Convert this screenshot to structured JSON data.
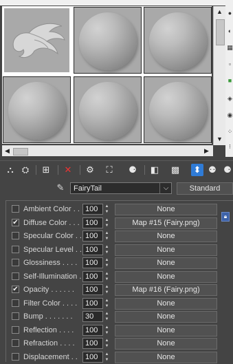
{
  "material": {
    "name": "FairyTail",
    "type": "Standard"
  },
  "maps": [
    {
      "label": "Ambient Color . .",
      "checked": false,
      "amount": "100",
      "map": "None"
    },
    {
      "label": "Diffuse Color . . .",
      "checked": true,
      "amount": "100",
      "map": "Map #15 (Fairy.png)"
    },
    {
      "label": "Specular Color . .",
      "checked": false,
      "amount": "100",
      "map": "None"
    },
    {
      "label": "Specular Level . .",
      "checked": false,
      "amount": "100",
      "map": "None"
    },
    {
      "label": "Glossiness . . . .",
      "checked": false,
      "amount": "100",
      "map": "None"
    },
    {
      "label": "Self-Illumination .",
      "checked": false,
      "amount": "100",
      "map": "None"
    },
    {
      "label": "Opacity . . . . . .",
      "checked": true,
      "amount": "100",
      "map": "Map #16 (Fairy.png)"
    },
    {
      "label": "Filter Color . . . .",
      "checked": false,
      "amount": "100",
      "map": "None"
    },
    {
      "label": "Bump . . . . . . .",
      "checked": false,
      "amount": "30",
      "map": "None"
    },
    {
      "label": "Reflection . . . .",
      "checked": false,
      "amount": "100",
      "map": "None"
    },
    {
      "label": "Refraction . . . .",
      "checked": false,
      "amount": "100",
      "map": "None"
    },
    {
      "label": "Displacement . .",
      "checked": false,
      "amount": "100",
      "map": "None"
    }
  ],
  "icons": {
    "checkmark": "✔",
    "dropdown": "⌵",
    "picker": "✎"
  }
}
